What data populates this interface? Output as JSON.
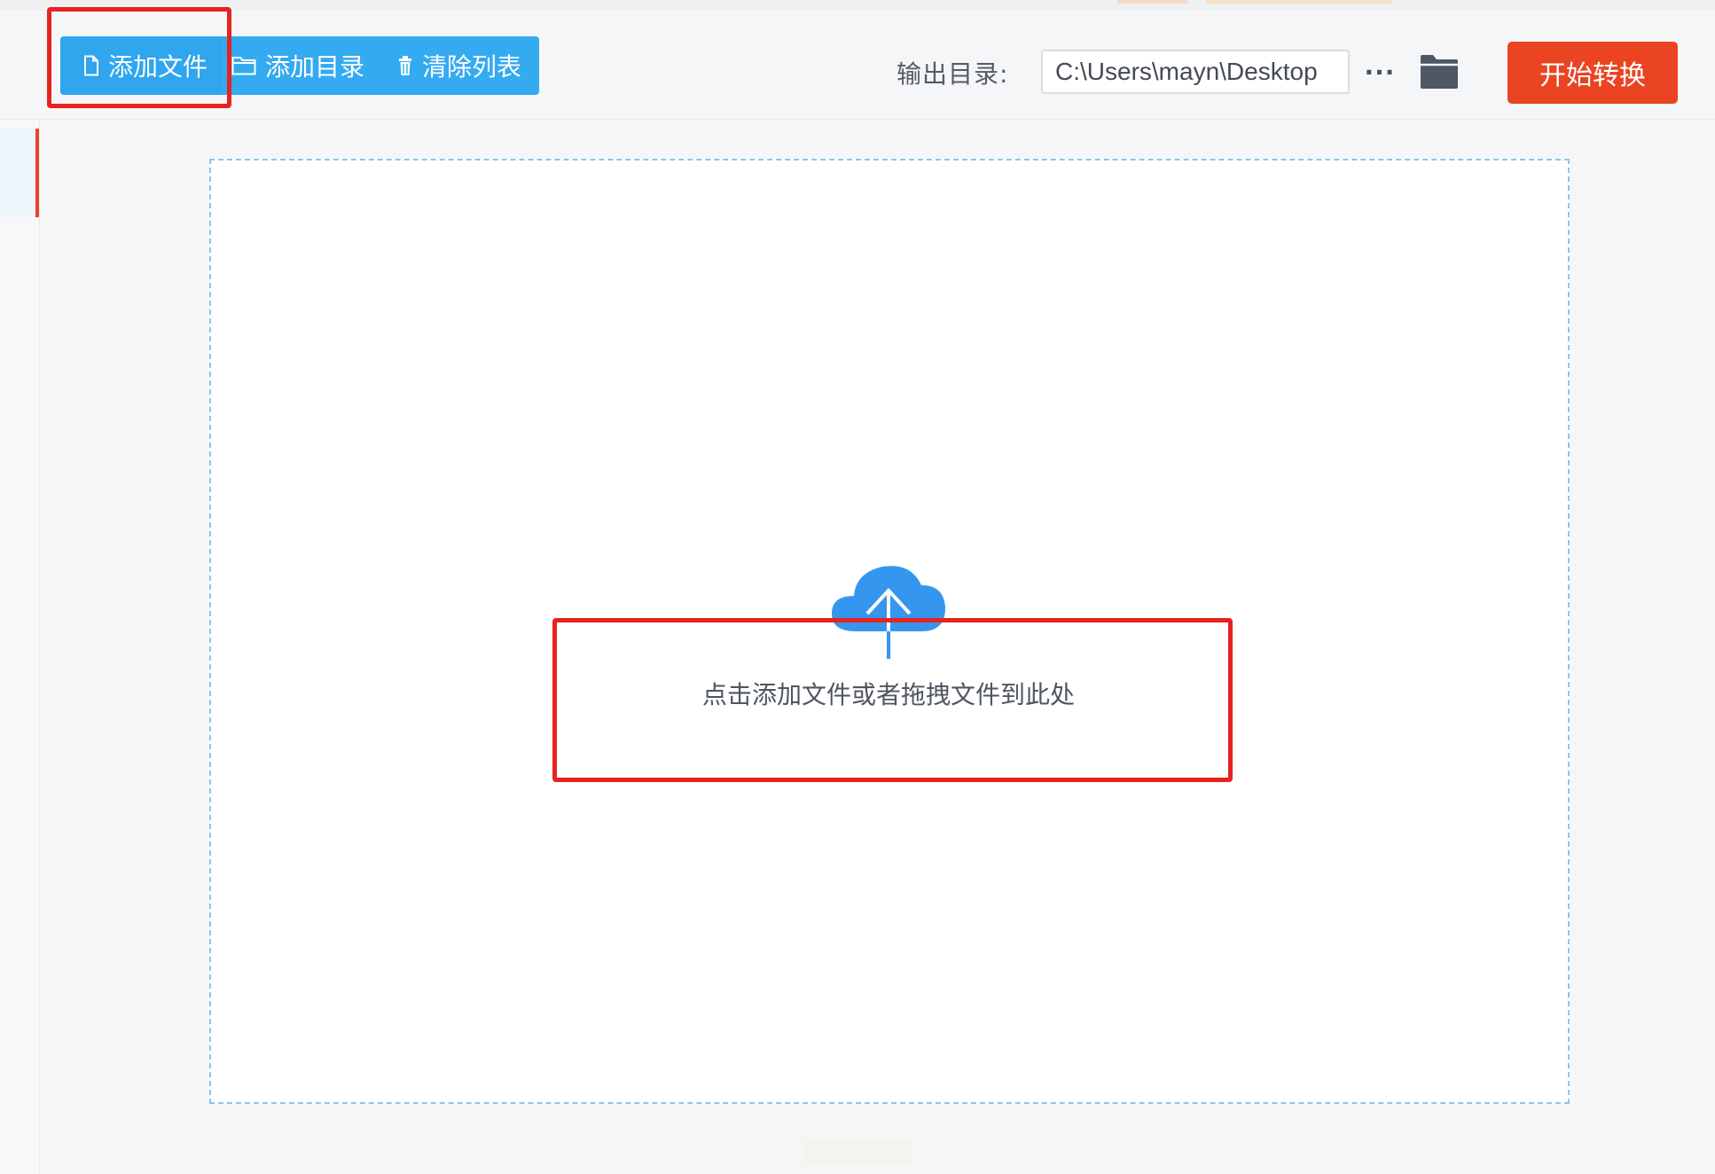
{
  "toolbar": {
    "add_file_label": "添加文件",
    "add_dir_label": "添加目录",
    "clear_list_label": "清除列表",
    "output_dir_label": "输出目录:",
    "output_dir_value": "C:\\Users\\mayn\\Desktop",
    "more_label": "···",
    "start_convert_label": "开始转换"
  },
  "drop_zone": {
    "hint": "点击添加文件或者拖拽文件到此处"
  },
  "icons": {
    "add_file": "file-icon",
    "add_dir": "folder-outline-icon",
    "clear_list": "trash-icon",
    "browse": "folder-icon",
    "upload": "cloud-upload-icon"
  },
  "colors": {
    "primary": "#34aaf0",
    "accent": "#ea4422",
    "highlight": "#e6231e",
    "upload_icon": "#3596ef"
  }
}
